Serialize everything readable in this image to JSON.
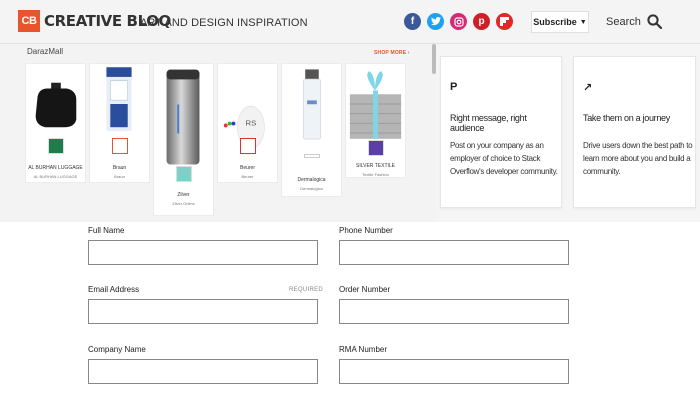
{
  "header": {
    "logo_badge": "CB",
    "logo_text": "CREATIVE BLOQ",
    "tagline": "ART AND DESIGN INSPIRATION",
    "social": [
      {
        "name": "facebook-icon",
        "glyph": "f",
        "color": "#3b5998"
      },
      {
        "name": "twitter-icon",
        "glyph": "t",
        "color": "#1da1f2"
      },
      {
        "name": "instagram-icon",
        "glyph": "◎",
        "color": "#d62976"
      },
      {
        "name": "pinterest-icon",
        "glyph": "p",
        "color": "#cb2027"
      },
      {
        "name": "flipboard-icon",
        "glyph": "f",
        "color": "#e12828"
      }
    ],
    "subscribe_label": "Subscribe",
    "subscribe_caret": "▼",
    "search_label": "Search"
  },
  "ad": {
    "brand": "DarazMall",
    "shop_more": "SHOP MORE ›",
    "products": [
      {
        "name": "AL BURHAN LUGGAGE",
        "sub": "AL BURHAN LUGGAGE"
      },
      {
        "name": "Braun",
        "sub": "Braun"
      },
      {
        "name": "Zilver",
        "sub": "Zilver Online"
      },
      {
        "name": "Beurer",
        "sub": "Beurer"
      },
      {
        "name": "Dermalogica",
        "sub": "Dermalogica"
      },
      {
        "name": "SILVER TEXTILE",
        "sub": "Textile Fashion"
      }
    ]
  },
  "cards": [
    {
      "icon": "P",
      "title": "Right message, right audience",
      "desc": "Post on your company as an employer of choice to Stack Overflow's developer community."
    },
    {
      "icon": "↗",
      "title": "Take them on a journey",
      "desc": "Drive users down the best path to learn more about you and build a community."
    }
  ],
  "form": {
    "full_name": {
      "label": "Full Name",
      "value": ""
    },
    "phone": {
      "label": "Phone Number",
      "value": ""
    },
    "email": {
      "label": "Email Address",
      "required": "REQUIRED",
      "value": ""
    },
    "order": {
      "label": "Order Number",
      "value": ""
    },
    "company": {
      "label": "Company Name",
      "value": ""
    },
    "rma": {
      "label": "RMA Number",
      "value": ""
    }
  },
  "colors": {
    "brand": "#e8542b"
  }
}
